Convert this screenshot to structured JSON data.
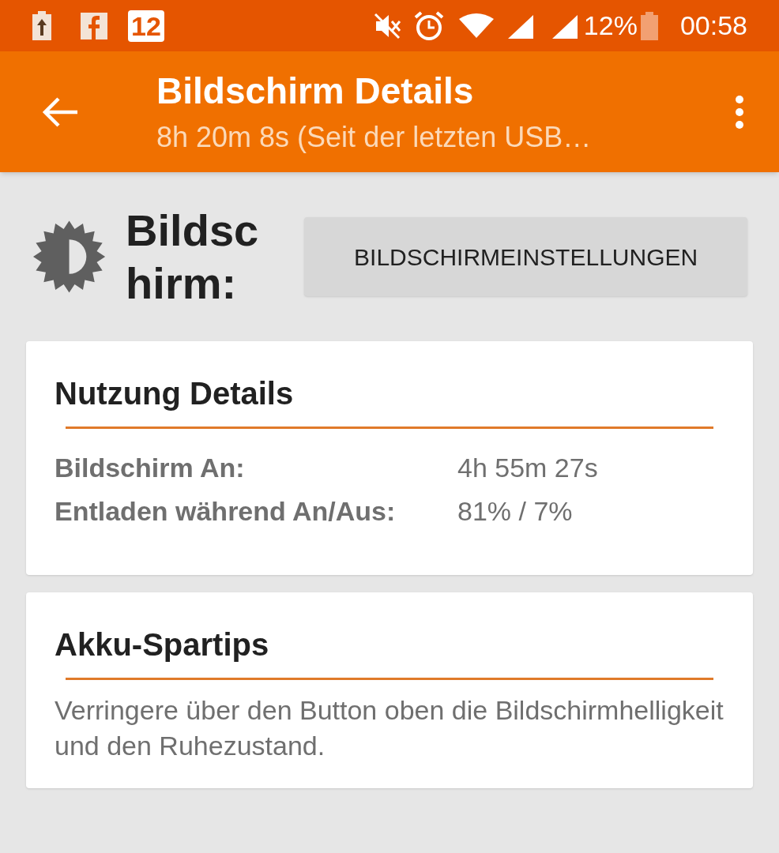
{
  "status_bar": {
    "notification_badge": "12",
    "battery_percent": "12%",
    "time": "00:58"
  },
  "app_bar": {
    "title": "Bildschirm Details",
    "subtitle": "8h 20m 8s (Seit der letzten USB…"
  },
  "header": {
    "title": "Bildschirm:",
    "button": "BILDSCHIRMEINSTELLUNGEN"
  },
  "usage_card": {
    "title": "Nutzung Details",
    "rows": [
      {
        "label": "Bildschirm An:",
        "value": "4h 55m 27s"
      },
      {
        "label": "Entladen während An/Aus:",
        "value": "81% / 7%"
      }
    ]
  },
  "tips_card": {
    "title": "Akku-Spartips",
    "text": "Verringere über den Button oben die Bildschirmhelligkeit und den Ruhezustand."
  }
}
